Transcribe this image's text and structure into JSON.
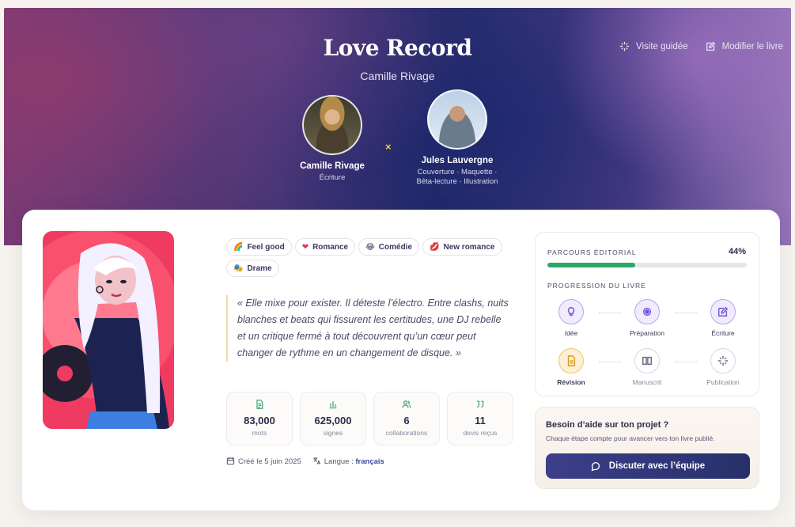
{
  "header": {
    "title": "Love Record",
    "author": "Camille Rivage",
    "actions": [
      {
        "label": "Visite guidée",
        "icon": "sparkle-icon"
      },
      {
        "label": "Modifier le livre",
        "icon": "edit-icon"
      }
    ]
  },
  "collaborators": [
    {
      "name": "Camille Rivage",
      "role": "Écriture"
    },
    {
      "name": "Jules Lauvergne",
      "role_line1": "Couverture · Maquette ·",
      "role_line2": "Bêta-lecture · Illustration"
    }
  ],
  "separator": "×",
  "tags": [
    {
      "label": "Feel good",
      "icon": "🌈"
    },
    {
      "label": "Romance",
      "icon": "❤"
    },
    {
      "label": "Comédie",
      "icon": "😂"
    },
    {
      "label": "New romance",
      "icon": "💋"
    },
    {
      "label": "Drame",
      "icon": "🎭"
    }
  ],
  "synopsis": "« Elle mixe pour exister. Il déteste l’électro. Entre clashs, nuits blanches et beats qui fissurent les certitudes, une DJ rebelle et un critique fermé à tout découvrent qu’un cœur peut changer de rythme en un changement de disque. »",
  "stats": [
    {
      "value": "83,000",
      "label": "mots",
      "icon": "document-icon"
    },
    {
      "value": "625,000",
      "label": "signes",
      "icon": "bar-chart-icon"
    },
    {
      "value": "6",
      "label": "collaborations",
      "icon": "users-icon"
    },
    {
      "value": "11",
      "label": "devis reçus",
      "icon": "quote-icon"
    }
  ],
  "meta": {
    "created": "Créé le 5 juin 2025",
    "language_label": "Langue :",
    "language_value": "français"
  },
  "progress": {
    "title": "PARCOURS ÉDITORIAL",
    "percent_label": "44%",
    "percent": 0.44,
    "subtitle": "PROGRESSION DU LIVRE",
    "steps": [
      {
        "label": "Idée",
        "state": "done"
      },
      {
        "label": "Préparation",
        "state": "done"
      },
      {
        "label": "Écriture",
        "state": "done"
      },
      {
        "label": "Révision",
        "state": "current"
      },
      {
        "label": "Manuscrit",
        "state": "todo"
      },
      {
        "label": "Publication",
        "state": "todo"
      }
    ]
  },
  "help": {
    "title": "Besoin d’aide sur ton projet ?",
    "subtitle": "Chaque étape compte pour avancer vers ton livre publié.",
    "button": "Discuter avec l’équipe"
  },
  "colors": {
    "accent_green": "#2aa86a",
    "accent_purple": "#6d55d8",
    "button_navy": "#2f3577",
    "highlight": "#f1c867"
  }
}
